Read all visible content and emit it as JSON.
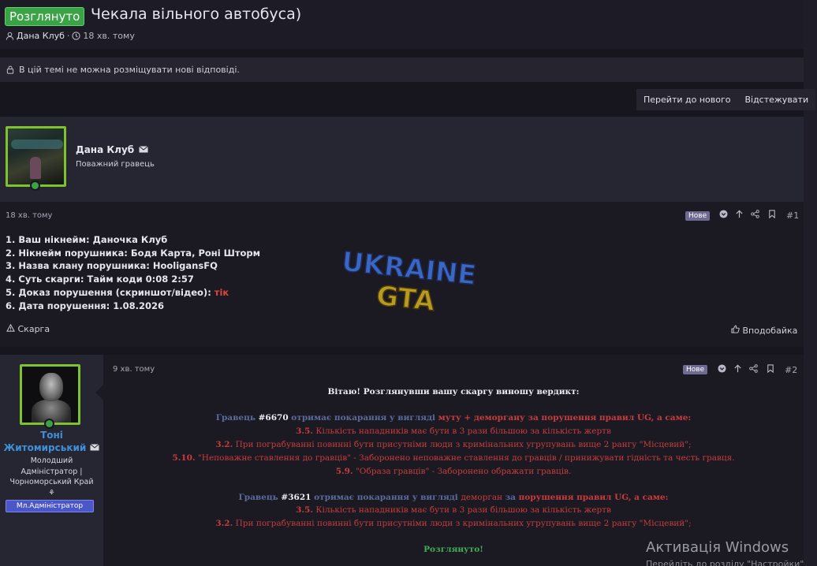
{
  "thread": {
    "status_badge": "Розглянуто",
    "title": "Чекала вільного автобуса)",
    "author": "Дана Клуб",
    "separator": "·",
    "time": "18 хв. тому"
  },
  "notice": "В цій темі не можна розміщувати нові відповіді.",
  "actions": {
    "go_new": "Перейти до нового",
    "watch": "Відстежувати"
  },
  "post1": {
    "username": "Дана Клуб",
    "user_title": "Поважний гравець",
    "time": "18 хв. тому",
    "new_badge": "Нове",
    "number": "#1",
    "lines": [
      "1. Ваш нікнейм: Даночка Клуб",
      "2. Нікнейм порушника: Бодя Карта, Роні Шторм",
      "3. Назва клану порушника: HooligansFQ",
      "4. Суть скарги: Тайм коди 0:08 2:57",
      "5. Доказ порушення (скриншот/відео): ",
      "6. Дата порушення: 1.08.2026"
    ],
    "evidence_link": "тік",
    "report": "Скарга",
    "like": "Вподобайка"
  },
  "watermark": {
    "line1": "UKRAINE",
    "line2": "GTA"
  },
  "post2": {
    "name_line1": "Тоні",
    "name_line2": "Житомирський",
    "title_line1": "Молодший",
    "title_line2": "Адміністратор |",
    "title_line3": "Чорноморський Край",
    "title_line4": "⚘",
    "role": "Мл.Адміністратор",
    "time": "9 хв. тому",
    "new_badge": "Нове",
    "number": "#2",
    "greeting": "Вітаю! Розглянувши вашу скаргу виношу вердикт:",
    "v1_a": "Гравець ",
    "v1_id": "#6670",
    "v1_b": " отримає покарання у вигляді ",
    "v1_c": "муту + деморгану за порушення правил UG, а саме:",
    "r1_num": "3.5.",
    "r1_text": " Кількість нападників має бути в 3 рази більшою за кількість жертв",
    "r2_num": "3.2.",
    "r2_text": " При пограбуванні повинні бути присутніми люди з кримінальних угрупувань вище 2 рангу \"Місцевий\";",
    "r3_num": "5.10.",
    "r3_text": " \"Неповажне ставлення до гравців\" - Заборонено неповажне ставлення до гравців / принижувати гідність та честь гравця.",
    "r4_num": "5.9.",
    "r4_text": " \"Образа гравців\" - Заборонено ображати гравців.",
    "v2_a": "Гравець ",
    "v2_id": "#3621",
    "v2_b": " отримає покарання у вигляді ",
    "v2_c": "деморган ",
    "v2_d": "за ",
    "v2_e": "порушення правил UG, а саме:",
    "r5_num": "3.5.",
    "r5_text": " Кількість нападників має бути в 3 рази більшою за кількість жертв",
    "r6_num": "3.2.",
    "r6_text": " При пограбуванні повинні бути присутніми люди з кримінальних угрупувань вище 2 рангу \"Місцевий\";",
    "resolved": "Розглянуто!"
  },
  "windows": {
    "activation": "Активація Windows",
    "hint": "Перейдіть до розділу \"Настройки\""
  },
  "colors": {
    "accent_green": "#3aa346",
    "link_blue": "#3f90d8",
    "verdict_red": "#c83c3c"
  }
}
